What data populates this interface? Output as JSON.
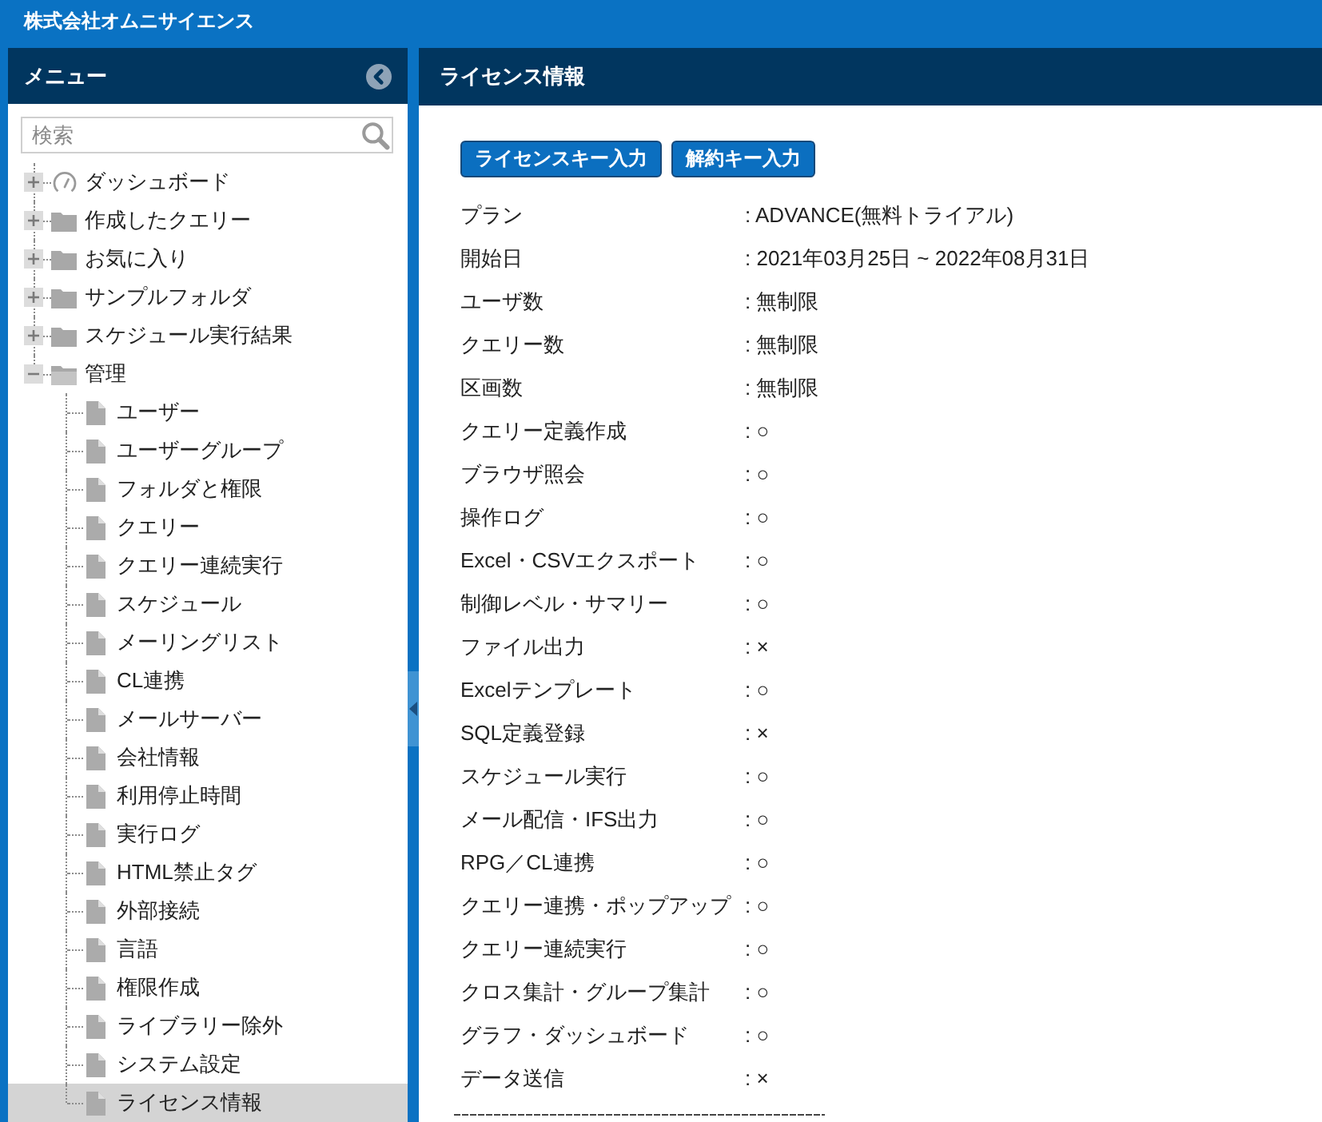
{
  "app_bar": {
    "title": "株式会社オムニサイエンス"
  },
  "menu": {
    "title": "メニュー",
    "search": {
      "placeholder": "検索"
    },
    "tree": [
      {
        "kind": "dashboard",
        "label": "ダッシュボード",
        "expanded": false,
        "selected": false
      },
      {
        "kind": "folder",
        "label": "作成したクエリー",
        "expanded": false,
        "selected": false
      },
      {
        "kind": "folder",
        "label": "お気に入り",
        "expanded": false,
        "selected": false
      },
      {
        "kind": "folder",
        "label": "サンプルフォルダ",
        "expanded": false,
        "selected": false
      },
      {
        "kind": "folder",
        "label": "スケジュール実行結果",
        "expanded": false,
        "selected": false
      },
      {
        "kind": "folder",
        "label": "管理",
        "expanded": true,
        "selected": false,
        "children": [
          {
            "kind": "file",
            "label": "ユーザー",
            "selected": false
          },
          {
            "kind": "file",
            "label": "ユーザーグループ",
            "selected": false
          },
          {
            "kind": "file",
            "label": "フォルダと権限",
            "selected": false
          },
          {
            "kind": "file",
            "label": "クエリー",
            "selected": false
          },
          {
            "kind": "file",
            "label": "クエリー連続実行",
            "selected": false
          },
          {
            "kind": "file",
            "label": "スケジュール",
            "selected": false
          },
          {
            "kind": "file",
            "label": "メーリングリスト",
            "selected": false
          },
          {
            "kind": "file",
            "label": "CL連携",
            "selected": false
          },
          {
            "kind": "file",
            "label": "メールサーバー",
            "selected": false
          },
          {
            "kind": "file",
            "label": "会社情報",
            "selected": false
          },
          {
            "kind": "file",
            "label": "利用停止時間",
            "selected": false
          },
          {
            "kind": "file",
            "label": "実行ログ",
            "selected": false
          },
          {
            "kind": "file",
            "label": "HTML禁止タグ",
            "selected": false
          },
          {
            "kind": "file",
            "label": "外部接続",
            "selected": false
          },
          {
            "kind": "file",
            "label": "言語",
            "selected": false
          },
          {
            "kind": "file",
            "label": "権限作成",
            "selected": false
          },
          {
            "kind": "file",
            "label": "ライブラリー除外",
            "selected": false
          },
          {
            "kind": "file",
            "label": "システム設定",
            "selected": false
          },
          {
            "kind": "file",
            "label": "ライセンス情報",
            "selected": true
          }
        ]
      }
    ]
  },
  "license": {
    "title": "ライセンス情報",
    "buttons": [
      "ライセンスキー入力",
      "解約キー入力"
    ],
    "rows": [
      {
        "label": "プラン",
        "value": ": ADVANCE(無料トライアル)"
      },
      {
        "label": "開始日",
        "value": ": 2021年03月25日 ~ 2022年08月31日"
      },
      {
        "label": "ユーザ数",
        "value": ": 無制限"
      },
      {
        "label": "クエリー数",
        "value": ": 無制限"
      },
      {
        "label": "区画数",
        "value": ": 無制限"
      },
      {
        "label": "クエリー定義作成",
        "value": ": ○"
      },
      {
        "label": "ブラウザ照会",
        "value": ": ○"
      },
      {
        "label": "操作ログ",
        "value": ": ○"
      },
      {
        "label": "Excel・CSVエクスポート",
        "value": ": ○"
      },
      {
        "label": "制御レベル・サマリー",
        "value": ": ○"
      },
      {
        "label": "ファイル出力",
        "value": ": ×"
      },
      {
        "label": "Excelテンプレート",
        "value": ": ○"
      },
      {
        "label": "SQL定義登録",
        "value": ": ×"
      },
      {
        "label": "スケジュール実行",
        "value": ": ○"
      },
      {
        "label": "メール配信・IFS出力",
        "value": ": ○"
      },
      {
        "label": "RPG／CL連携",
        "value": ": ○"
      },
      {
        "label": "クエリー連携・ポップアップ",
        "value": ": ○"
      },
      {
        "label": "クエリー連続実行",
        "value": ": ○"
      },
      {
        "label": "クロス集計・グループ集計",
        "value": ": ○"
      },
      {
        "label": "グラフ・ダッシュボード",
        "value": ": ○"
      },
      {
        "label": "データ送信",
        "value": ": ×"
      }
    ]
  }
}
